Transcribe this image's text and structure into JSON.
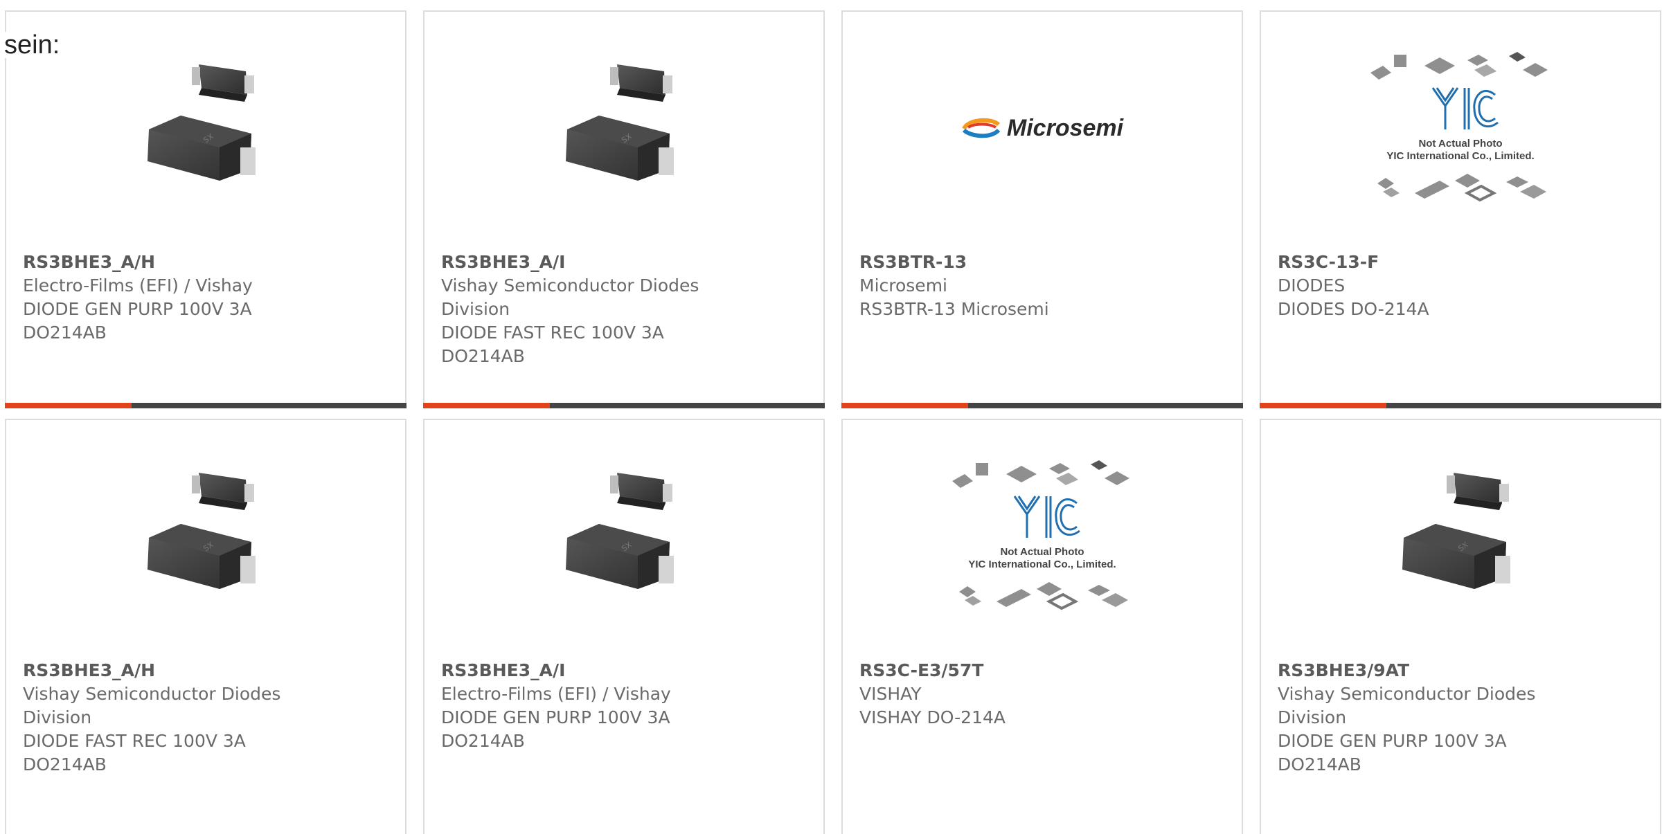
{
  "intro": {
    "label": "sein:"
  },
  "products": [
    {
      "part": "RS3BHE3_A/H",
      "lines": [
        "Electro-Films (EFI) / Vishay",
        "DIODE GEN PURP 100V 3A",
        "DO214AB"
      ],
      "image": "diode-package"
    },
    {
      "part": "RS3BHE3_A/I",
      "lines": [
        "Vishay Semiconductor Diodes",
        "Division",
        "DIODE FAST REC 100V 3A",
        "DO214AB"
      ],
      "image": "diode-package"
    },
    {
      "part": "RS3BTR-13",
      "lines": [
        "Microsemi",
        "RS3BTR-13 Microsemi"
      ],
      "image": "microsemi-logo",
      "logo_text": "Microsemi"
    },
    {
      "part": "RS3C-13-F",
      "lines": [
        "DIODES",
        "DIODES DO-214A"
      ],
      "image": "yic-placeholder",
      "placeholder_lines": [
        "Not Actual Photo",
        "YIC International Co., Limited."
      ]
    },
    {
      "part": "RS3BHE3_A/H",
      "lines": [
        "Vishay Semiconductor Diodes",
        "Division",
        "DIODE FAST REC 100V 3A",
        "DO214AB"
      ],
      "image": "diode-package"
    },
    {
      "part": "RS3BHE3_A/I",
      "lines": [
        "Electro-Films (EFI) / Vishay",
        "DIODE GEN PURP 100V 3A",
        "DO214AB"
      ],
      "image": "diode-package"
    },
    {
      "part": "RS3C-E3/57T",
      "lines": [
        "VISHAY",
        "VISHAY DO-214A"
      ],
      "image": "yic-placeholder",
      "placeholder_lines": [
        "Not Actual Photo",
        "YIC International Co., Limited."
      ]
    },
    {
      "part": "RS3BHE3/9AT",
      "lines": [
        "Vishay Semiconductor Diodes",
        "Division",
        "DIODE GEN PURP 100V 3A",
        "DO214AB"
      ],
      "image": "diode-package"
    }
  ],
  "colors": {
    "accent": "#e2431b",
    "bar": "#444444",
    "border": "#dcdcdc",
    "text": "#6a6a6a"
  }
}
